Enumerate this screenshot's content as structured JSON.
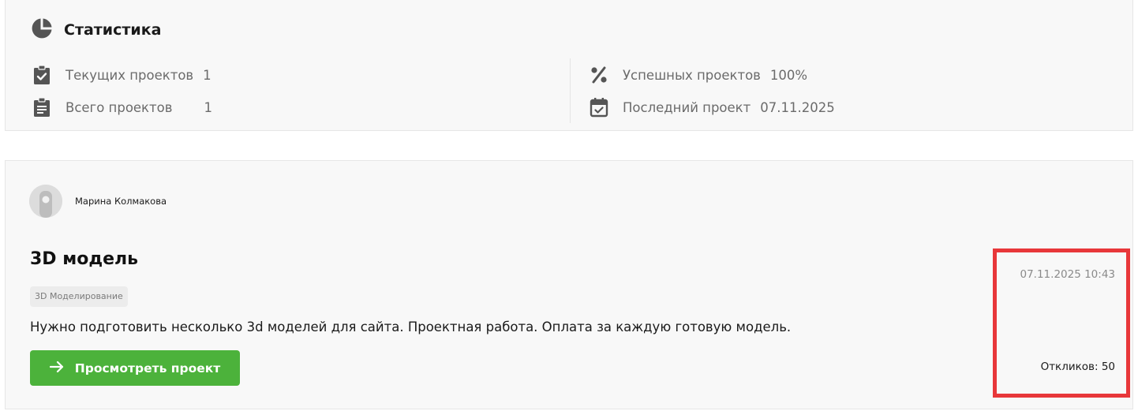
{
  "stats": {
    "title": "Статистика",
    "items": [
      {
        "label": "Текущих проектов",
        "value": "1",
        "icon": "clipboard-check-icon"
      },
      {
        "label": "Всего проектов",
        "value": "1",
        "icon": "clipboard-list-icon"
      },
      {
        "label": "Успешных проектов",
        "value": "100%",
        "icon": "percent-icon"
      },
      {
        "label": "Последний проект",
        "value": "07.11.2025",
        "icon": "calendar-check-icon"
      }
    ]
  },
  "project": {
    "author": "Марина Колмакова",
    "title": "3D модель",
    "tag": "3D Моделирование",
    "description": "Нужно подготовить несколько 3d моделей для сайта. Проектная работа. Оплата за каждую готовую модель.",
    "button_label": "Просмотреть проект",
    "posted_at": "07.11.2025 10:43",
    "responses": "Откликов: 50"
  },
  "colors": {
    "accent_green": "#4cb23b",
    "highlight_red": "#e8373a",
    "card_bg": "#f8f8f8"
  }
}
